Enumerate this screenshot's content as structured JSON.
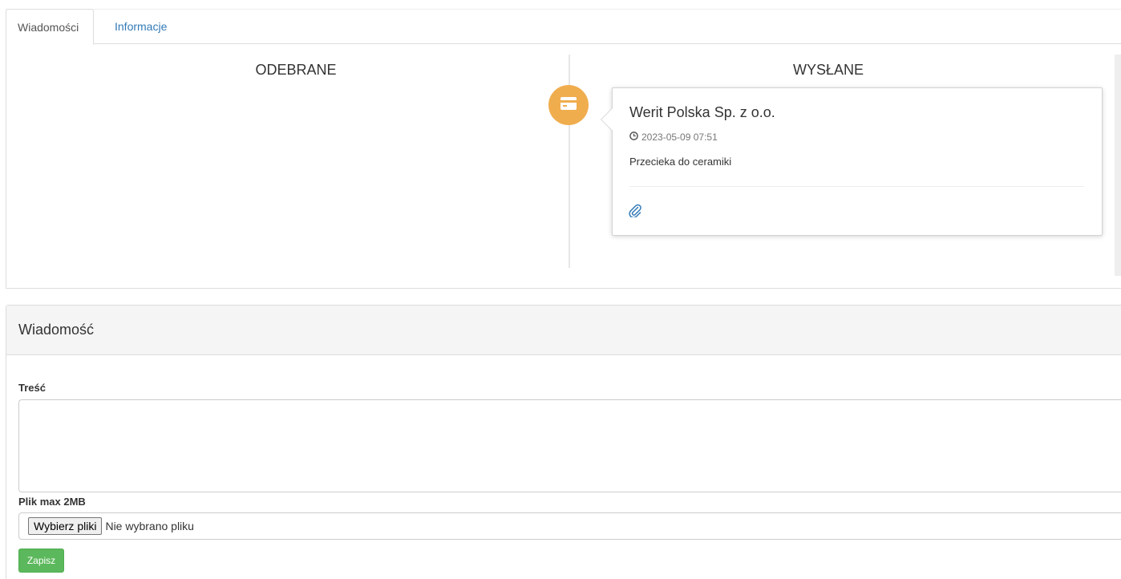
{
  "tabs": [
    {
      "label": "Wiadomości",
      "active": true
    },
    {
      "label": "Informacje",
      "active": false
    }
  ],
  "timeline": {
    "received_heading": "ODEBRANE",
    "sent_heading": "WYSŁANE",
    "badge_icon": "credit-card-icon",
    "badge_color": "#f0ad4e",
    "sent_messages": [
      {
        "sender": "Werit Polska Sp. z o.o.",
        "timestamp": "2023-05-09 07:51",
        "timestamp_icon": "clock-icon",
        "body": "Przecieka do ceramiki",
        "attachment_icon": "paperclip-icon"
      }
    ]
  },
  "form": {
    "heading": "Wiadomość",
    "content_label": "Treść",
    "content_value": "",
    "file_label": "Plik max 2MB",
    "file_button_label": "Wybierz pliki",
    "file_status": "Nie wybrano pliku",
    "save_label": "Zapisz",
    "save_color": "#5cb85c"
  },
  "colors": {
    "link": "#337ab7"
  }
}
